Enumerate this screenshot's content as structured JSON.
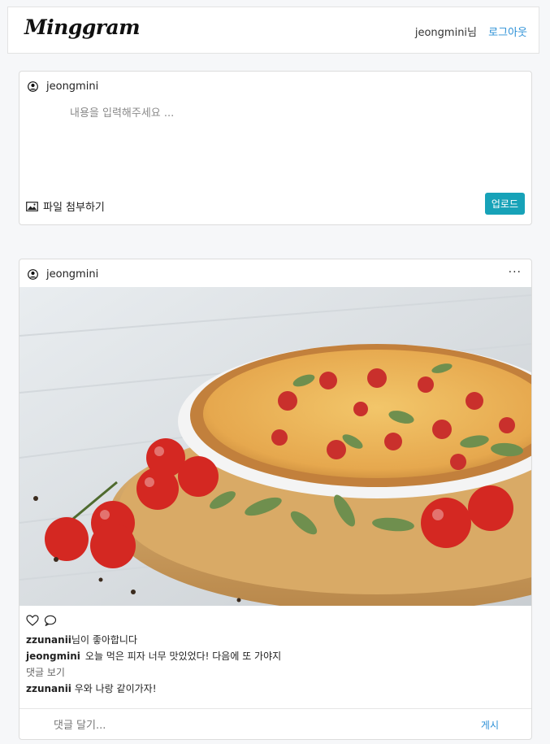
{
  "header": {
    "brand": "Minggram",
    "username_greeting": "jeongmini님",
    "logout_label": "로그아웃"
  },
  "composer": {
    "username": "jeongmini",
    "placeholder": "내용을 입력해주세요 ...",
    "attach_label": "파일 첨부하기",
    "upload_label": "업로드"
  },
  "post": {
    "username": "jeongmini",
    "more_label": "···",
    "image_subject": "pizza-photo",
    "likes_user": "zzunanii",
    "likes_suffix": "님이 좋아합니다",
    "caption_user": "jeongmini",
    "caption_text": "오늘 먹은 피자 너무 맛있었다! 다음에 또 가야지",
    "view_comments_label": "댓글 보기",
    "comments": [
      {
        "user": "zzunanii",
        "text": "우와 나랑 같이가자!"
      }
    ],
    "comment_placeholder": "댓글 달기...",
    "post_comment_label": "게시"
  },
  "colors": {
    "accent": "#17a2b8",
    "link": "#2a8fd6",
    "background": "#f6f7f9"
  }
}
